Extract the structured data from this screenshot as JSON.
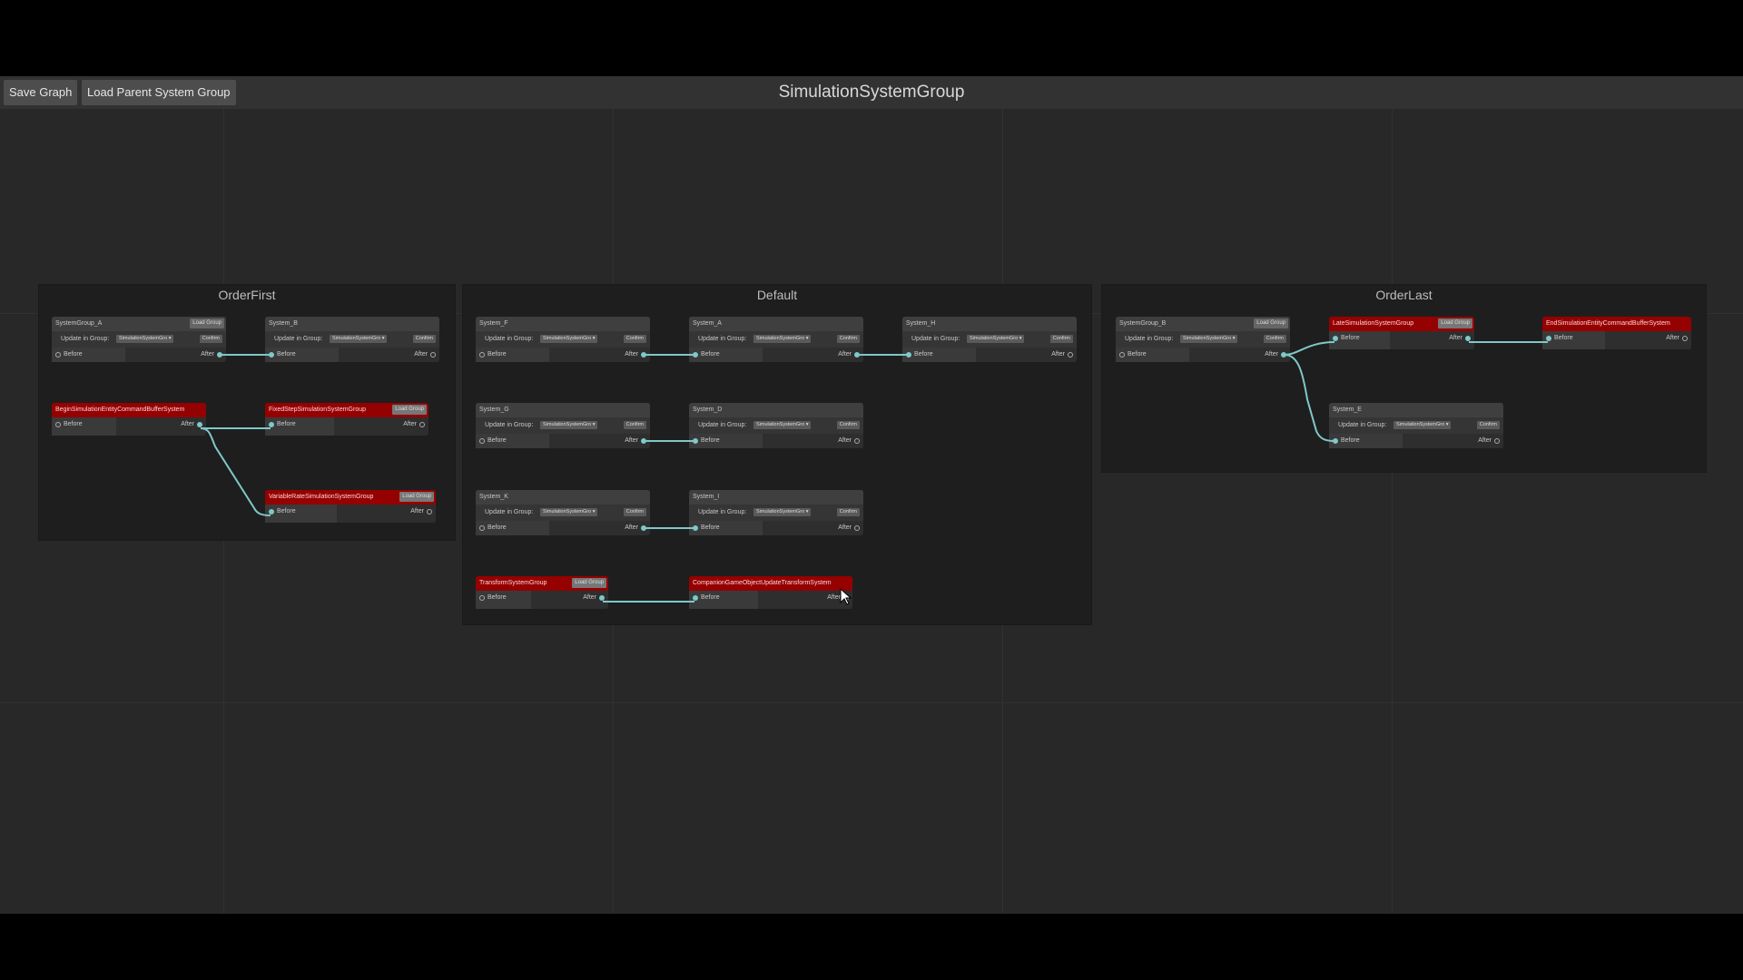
{
  "toolbar": {
    "save_label": "Save Graph",
    "load_parent_label": "Load Parent System Group"
  },
  "graph_title": "SimulationSystemGroup",
  "labels": {
    "update_in_group": "Update in Group:",
    "confirm": "Confirm",
    "before": "Before",
    "after": "After",
    "load_group": "Load Group",
    "dropdown_value": "SimulationSystemGro ▾"
  },
  "groups": {
    "order_first": "OrderFirst",
    "default": "Default",
    "order_last": "OrderLast"
  },
  "nodes": {
    "systemgroup_a": "SystemGroup_A",
    "system_b": "System_B",
    "begin_sim_ecb": "BeginSimulationEntityCommandBufferSystem",
    "fixed_step": "FixedStepSimulationSystemGroup",
    "variable_rate": "VariableRateSimulationSystemGroup",
    "system_f": "System_F",
    "system_a": "System_A",
    "system_h": "System_H",
    "system_g": "System_G",
    "system_d": "System_D",
    "system_k": "System_K",
    "system_i": "System_I",
    "transform_group": "TransformSystemGroup",
    "companion": "CompanionGameObjectUpdateTransformSystem",
    "systemgroup_b": "SystemGroup_B",
    "late_sim": "LateSimulationSystemGroup",
    "end_sim_ecb": "EndSimulationEntityCommandBufferSystem",
    "system_e": "System_E"
  },
  "colors": {
    "edge": "#7fc8c8",
    "group_node_header": "#950000"
  }
}
